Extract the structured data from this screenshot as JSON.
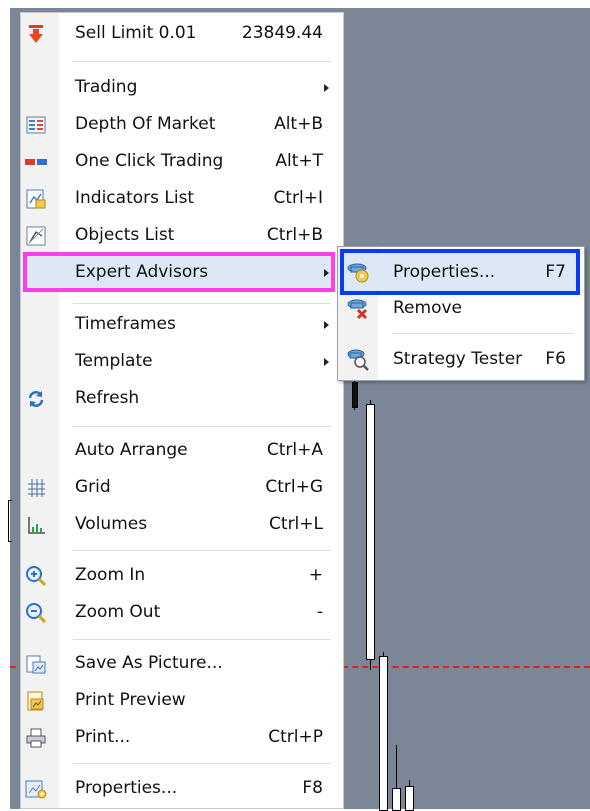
{
  "menu": {
    "items": [
      {
        "label": "Sell Limit 0.01",
        "shortcut": "23849.44",
        "icon": "sell-arrow-icon"
      },
      {
        "label": "Trading",
        "shortcut": "",
        "submenu": true
      },
      {
        "label": "Depth Of Market",
        "shortcut": "Alt+B",
        "icon": "depth-of-market-icon"
      },
      {
        "label": "One Click Trading",
        "shortcut": "Alt+T",
        "icon": "one-click-trading-icon"
      },
      {
        "label": "Indicators List",
        "shortcut": "Ctrl+I",
        "icon": "indicators-list-icon"
      },
      {
        "label": "Objects List",
        "shortcut": "Ctrl+B",
        "icon": "objects-list-icon"
      },
      {
        "label": "Expert Advisors",
        "shortcut": "",
        "submenu": true,
        "highlighted": true
      },
      {
        "label": "Timeframes",
        "shortcut": "",
        "submenu": true
      },
      {
        "label": "Template",
        "shortcut": "",
        "submenu": true
      },
      {
        "label": "Refresh",
        "shortcut": "",
        "icon": "refresh-icon"
      },
      {
        "label": "Auto Arrange",
        "shortcut": "Ctrl+A"
      },
      {
        "label": "Grid",
        "shortcut": "Ctrl+G",
        "icon": "grid-icon"
      },
      {
        "label": "Volumes",
        "shortcut": "Ctrl+L",
        "icon": "volumes-icon"
      },
      {
        "label": "Zoom In",
        "shortcut": "+",
        "icon": "zoom-in-icon"
      },
      {
        "label": "Zoom Out",
        "shortcut": "-",
        "icon": "zoom-out-icon"
      },
      {
        "label": "Save As Picture...",
        "shortcut": "",
        "icon": "save-picture-icon"
      },
      {
        "label": "Print Preview",
        "shortcut": "",
        "icon": "print-preview-icon"
      },
      {
        "label": "Print...",
        "shortcut": "Ctrl+P",
        "icon": "print-icon"
      },
      {
        "label": "Properties...",
        "shortcut": "F8",
        "icon": "properties-icon"
      }
    ]
  },
  "submenu": {
    "items": [
      {
        "label": "Properties...",
        "shortcut": "F7",
        "icon": "expert-properties-icon",
        "highlighted": true
      },
      {
        "label": "Remove",
        "shortcut": "",
        "icon": "expert-remove-icon"
      },
      {
        "label": "Strategy Tester",
        "shortcut": "F6",
        "icon": "strategy-tester-icon"
      }
    ]
  },
  "colors": {
    "chart_background": "#7b8797",
    "menu_highlight_border": "#ff3cf0",
    "submenu_highlight_border": "#0b3bf0",
    "highlight_fill": "#dce8f5"
  }
}
